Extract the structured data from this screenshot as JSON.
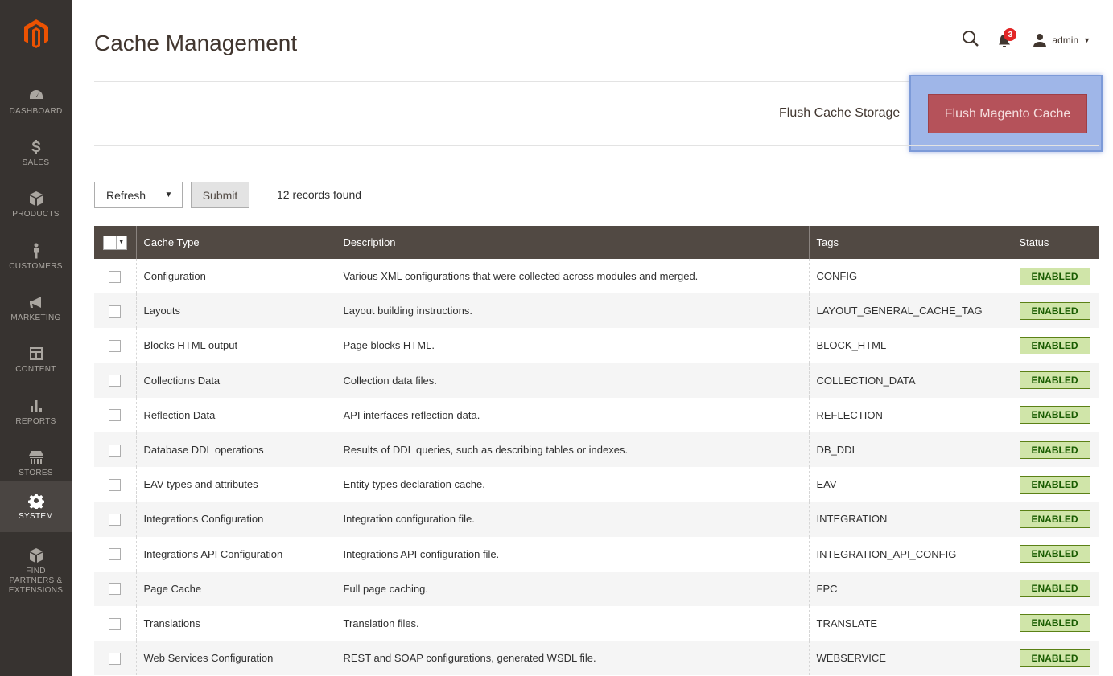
{
  "sidebar": {
    "items": [
      {
        "label": "DASHBOARD",
        "icon": "dashboard-icon"
      },
      {
        "label": "SALES",
        "icon": "dollar-icon"
      },
      {
        "label": "PRODUCTS",
        "icon": "cube-icon"
      },
      {
        "label": "CUSTOMERS",
        "icon": "person-icon"
      },
      {
        "label": "MARKETING",
        "icon": "megaphone-icon"
      },
      {
        "label": "CONTENT",
        "icon": "layout-icon"
      },
      {
        "label": "REPORTS",
        "icon": "bar-chart-icon"
      },
      {
        "label": "STORES",
        "icon": "store-icon"
      },
      {
        "label": "SYSTEM",
        "icon": "gear-icon"
      },
      {
        "label": "FIND PARTNERS & EXTENSIONS",
        "icon": "cubes-icon"
      }
    ],
    "active": "SYSTEM"
  },
  "header": {
    "title": "Cache Management",
    "notifications_count": "3",
    "user": "admin"
  },
  "actions": {
    "flush_storage": "Flush Cache Storage",
    "flush_magento": "Flush Magento Cache"
  },
  "massaction": {
    "selected": "Refresh",
    "submit": "Submit",
    "records": "12 records found"
  },
  "grid": {
    "columns": [
      "Cache Type",
      "Description",
      "Tags",
      "Status"
    ],
    "rows": [
      {
        "type": "Configuration",
        "description": "Various XML configurations that were collected across modules and merged.",
        "tags": "CONFIG",
        "status": "ENABLED"
      },
      {
        "type": "Layouts",
        "description": "Layout building instructions.",
        "tags": "LAYOUT_GENERAL_CACHE_TAG",
        "status": "ENABLED"
      },
      {
        "type": "Blocks HTML output",
        "description": "Page blocks HTML.",
        "tags": "BLOCK_HTML",
        "status": "ENABLED"
      },
      {
        "type": "Collections Data",
        "description": "Collection data files.",
        "tags": "COLLECTION_DATA",
        "status": "ENABLED"
      },
      {
        "type": "Reflection Data",
        "description": "API interfaces reflection data.",
        "tags": "REFLECTION",
        "status": "ENABLED"
      },
      {
        "type": "Database DDL operations",
        "description": "Results of DDL queries, such as describing tables or indexes.",
        "tags": "DB_DDL",
        "status": "ENABLED"
      },
      {
        "type": "EAV types and attributes",
        "description": "Entity types declaration cache.",
        "tags": "EAV",
        "status": "ENABLED"
      },
      {
        "type": "Integrations Configuration",
        "description": "Integration configuration file.",
        "tags": "INTEGRATION",
        "status": "ENABLED"
      },
      {
        "type": "Integrations API Configuration",
        "description": "Integrations API configuration file.",
        "tags": "INTEGRATION_API_CONFIG",
        "status": "ENABLED"
      },
      {
        "type": "Page Cache",
        "description": "Full page caching.",
        "tags": "FPC",
        "status": "ENABLED"
      },
      {
        "type": "Translations",
        "description": "Translation files.",
        "tags": "TRANSLATE",
        "status": "ENABLED"
      },
      {
        "type": "Web Services Configuration",
        "description": "REST and SOAP configurations, generated WSDL file.",
        "tags": "WEBSERVICE",
        "status": "ENABLED"
      }
    ]
  },
  "colors": {
    "sidebar_bg": "#373330",
    "accent": "#eb5202",
    "flush_button": "#b5525a",
    "header_row": "#514943",
    "status_bg": "#d0e5a9"
  }
}
